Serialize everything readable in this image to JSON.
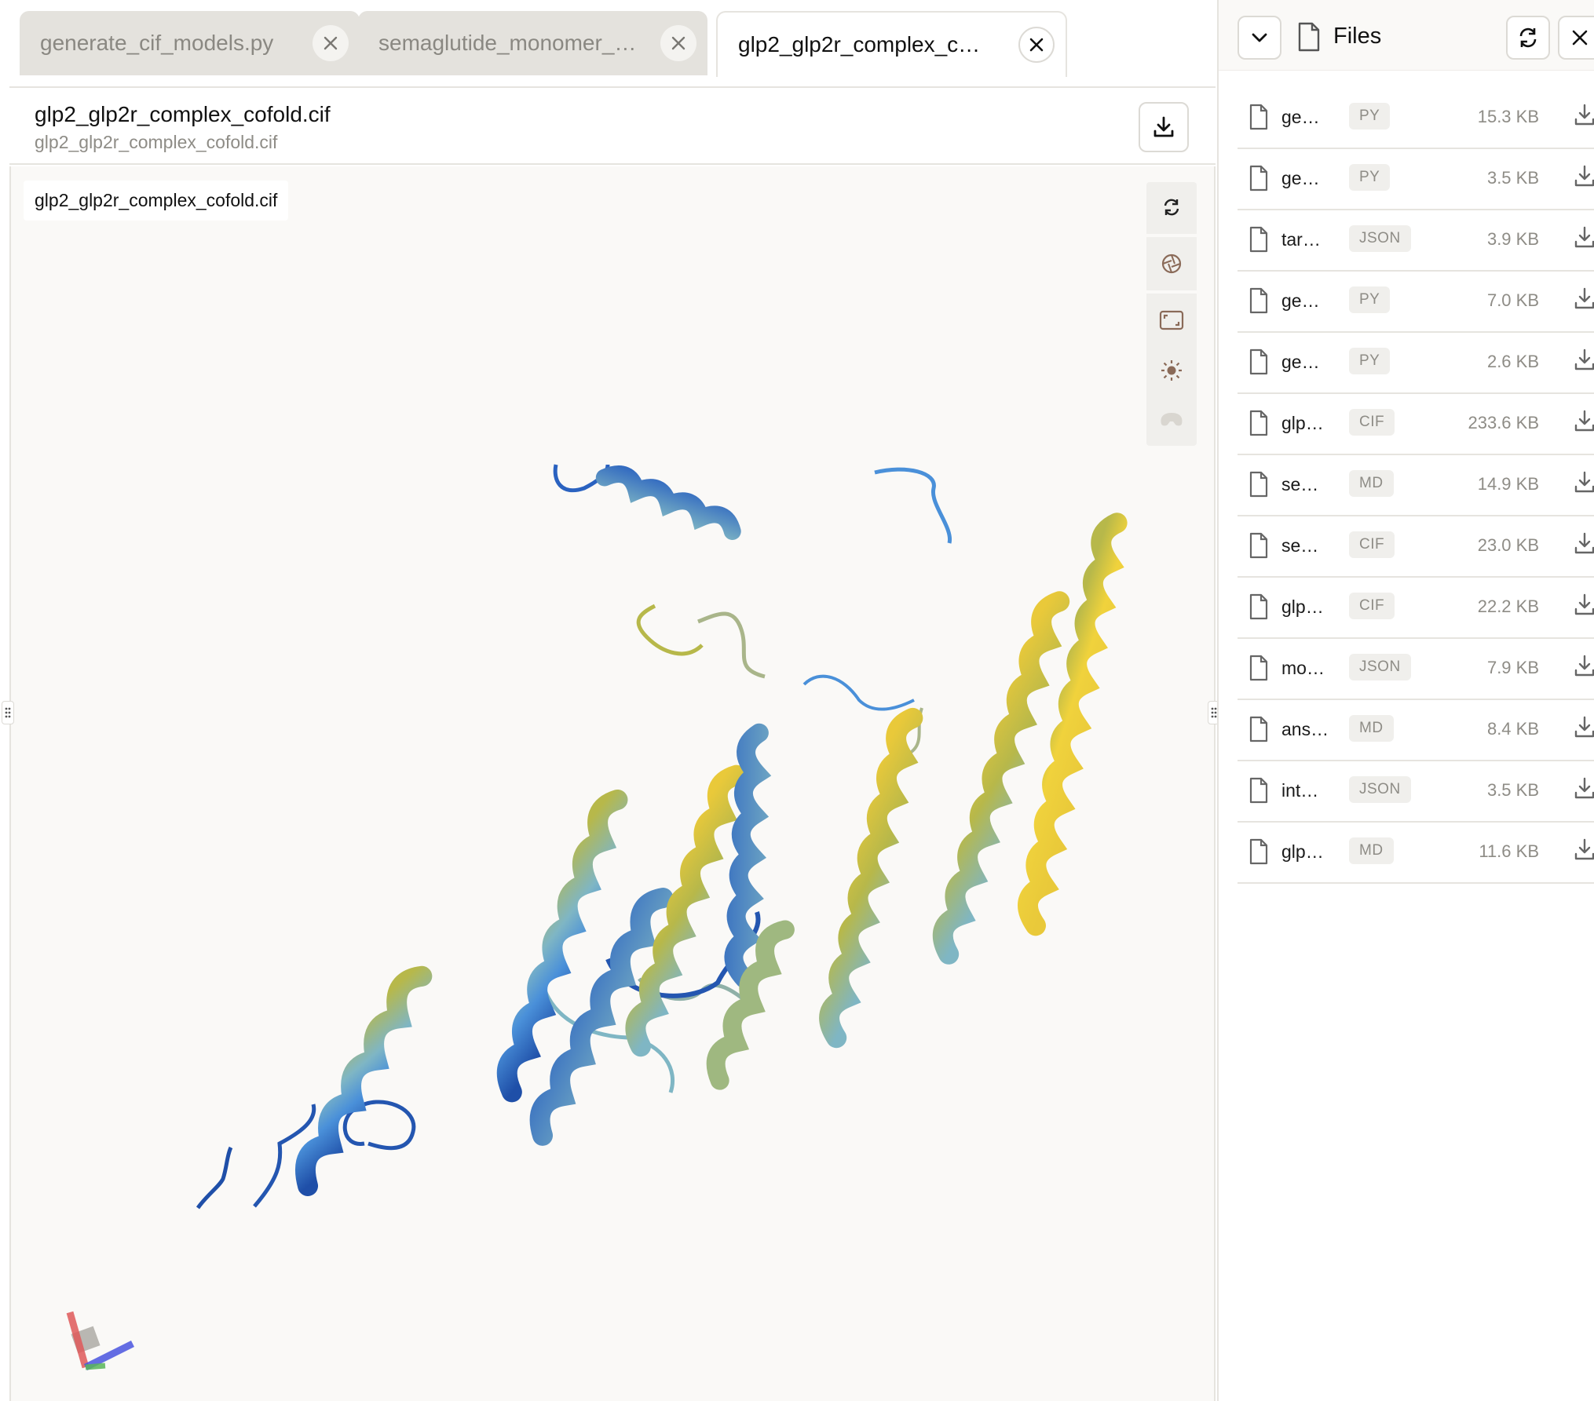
{
  "tabs": [
    {
      "label": "generate_cif_models.py",
      "active": false
    },
    {
      "label": "semaglutide_monomer_…",
      "active": false
    },
    {
      "label": "glp2_glp2r_complex_c…",
      "active": true
    }
  ],
  "file_header": {
    "title": "glp2_glp2r_complex_cofold.cif",
    "subtitle": "glp2_glp2r_complex_cofold.cif",
    "download_icon": "download-icon"
  },
  "viewer": {
    "label": "glp2_glp2r_complex_cofold.cif",
    "toolbar": [
      "reset-view-icon",
      "screenshot-icon",
      "fullscreen-icon",
      "lighting-icon",
      "vr-icon"
    ],
    "colors": {
      "deep_blue": "#1f4fa8",
      "sky_blue": "#4a90d9",
      "teal": "#7fb6c4",
      "olive": "#b7b84a",
      "gold": "#e9c93a"
    }
  },
  "files_panel": {
    "title": "Files",
    "files": [
      {
        "name": "ge…",
        "type": "PY",
        "size": "15.3 KB"
      },
      {
        "name": "ge…",
        "type": "PY",
        "size": "3.5 KB"
      },
      {
        "name": "tar…",
        "type": "JSON",
        "size": "3.9 KB"
      },
      {
        "name": "ge…",
        "type": "PY",
        "size": "7.0 KB"
      },
      {
        "name": "ge…",
        "type": "PY",
        "size": "2.6 KB"
      },
      {
        "name": "glp…",
        "type": "CIF",
        "size": "233.6 KB"
      },
      {
        "name": "se…",
        "type": "MD",
        "size": "14.9 KB"
      },
      {
        "name": "se…",
        "type": "CIF",
        "size": "23.0 KB"
      },
      {
        "name": "glp…",
        "type": "CIF",
        "size": "22.2 KB"
      },
      {
        "name": "mo…",
        "type": "JSON",
        "size": "7.9 KB"
      },
      {
        "name": "ans…",
        "type": "MD",
        "size": "8.4 KB"
      },
      {
        "name": "int…",
        "type": "JSON",
        "size": "3.5 KB"
      },
      {
        "name": "glp…",
        "type": "MD",
        "size": "11.6 KB"
      }
    ]
  }
}
